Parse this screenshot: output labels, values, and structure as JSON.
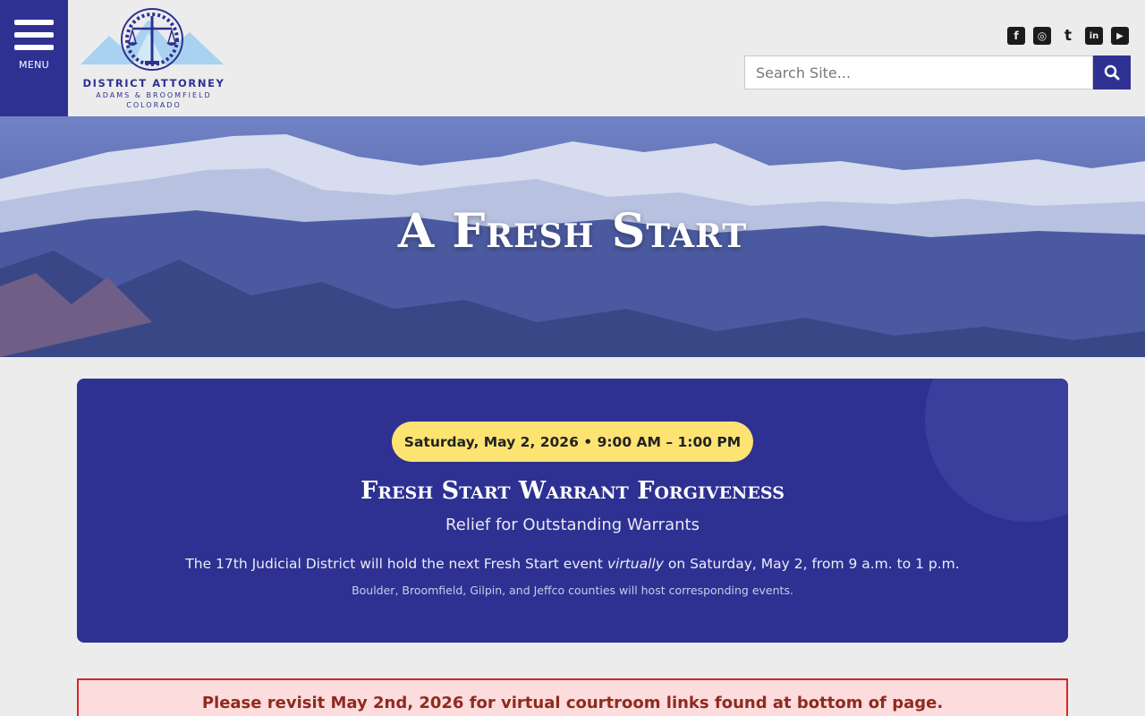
{
  "header": {
    "menu_label": "MENU",
    "logo": {
      "title": "DISTRICT ATTORNEY",
      "subtitle": "ADAMS & BROOMFIELD",
      "state": "COLORADO"
    },
    "socials": [
      {
        "name": "facebook",
        "glyph": "f"
      },
      {
        "name": "instagram",
        "glyph": "◎"
      },
      {
        "name": "twitter",
        "glyph": "t"
      },
      {
        "name": "linkedin",
        "glyph": "in"
      },
      {
        "name": "youtube",
        "glyph": "▶"
      }
    ],
    "search": {
      "placeholder": "Search Site..."
    }
  },
  "hero": {
    "title": "A Fresh Start"
  },
  "event": {
    "date_time": "Saturday, May 2, 2026 • 9:00 AM – 1:00 PM",
    "title": "Fresh Start Warrant Forgiveness",
    "subtitle": "Relief for Outstanding Warrants",
    "body_before": "The 17th Judicial District will hold the next Fresh Start event ",
    "body_emphasis": "virtually",
    "body_after": " on Saturday, May 2, from 9 a.m. to 1 p.m.",
    "note": "Boulder, Broomfield, Gilpin, and Jeffco counties will host corresponding events."
  },
  "alert": {
    "text": "Please revisit May 2nd, 2026 for virtual courtroom links found at bottom of page."
  },
  "colors": {
    "brand": "#2e3192",
    "pill": "#fde372",
    "alert_bg": "#fcdcdc",
    "alert_border": "#d9252b",
    "alert_text": "#8f2a1f"
  }
}
